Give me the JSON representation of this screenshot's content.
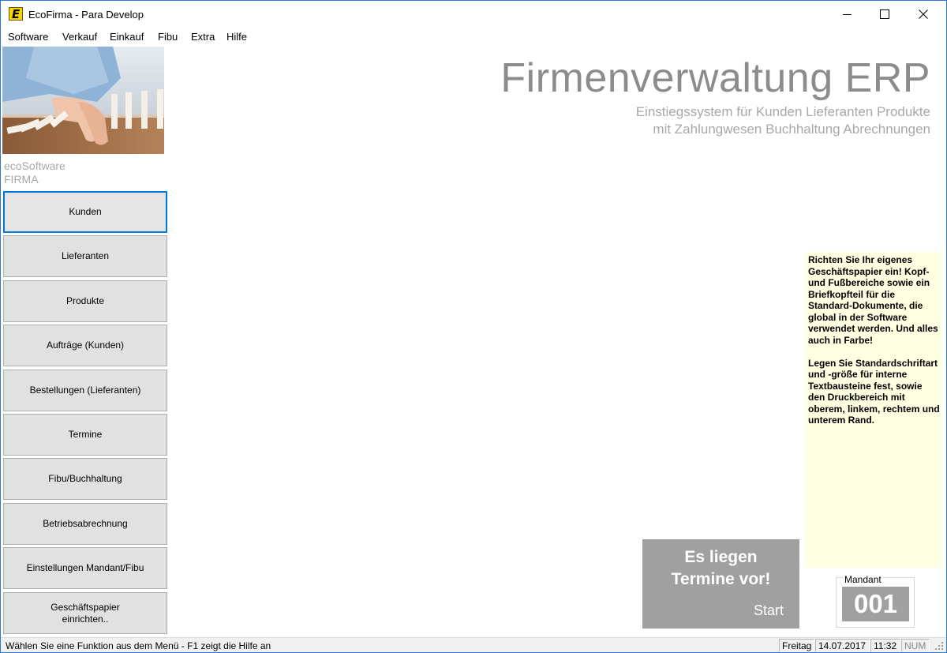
{
  "window": {
    "title": "EcoFirma - Para Develop",
    "logo_letter": "E"
  },
  "menu": [
    {
      "label": "Software"
    },
    {
      "label": "Verkauf"
    },
    {
      "label": "Einkauf"
    },
    {
      "label": "Fibu"
    },
    {
      "label": "Extra"
    },
    {
      "label": "Hilfe"
    }
  ],
  "brand": {
    "line1": "ecoSoftware",
    "line2": "FIRMA"
  },
  "nav": [
    {
      "label": "Kunden"
    },
    {
      "label": "Lieferanten"
    },
    {
      "label": "Produkte"
    },
    {
      "label": "Aufträge (Kunden)"
    },
    {
      "label": "Bestellungen (Lieferanten)"
    },
    {
      "label": "Termine"
    },
    {
      "label": "Fibu/Buchhaltung"
    },
    {
      "label": "Betriebsabrechnung"
    },
    {
      "label": "Einstellungen Mandant/Fibu"
    },
    {
      "label": "Geschäftspapier\neinrichten.."
    }
  ],
  "headline": {
    "title": "Firmenverwaltung ERP",
    "subtitle_1": "Einstiegssystem für Kunden Lieferanten Produkte",
    "subtitle_2": "mit Zahlungwesen Buchhaltung Abrechnungen"
  },
  "hint": {
    "paragraph_1": "Richten Sie Ihr eigenes Geschäftspapier ein! Kopf- und Fußbereiche sowie ein Briefkopfteil für die Standard-Dokumente, die global in der Software verwendet werden. Und alles auch in Farbe!",
    "paragraph_2": "Legen Sie Standardschriftart und -größe für interne Textbausteine fest, sowie den Druckbereich mit oberem, linkem, rechtem und unterem Rand."
  },
  "appointments": {
    "line_1": "Es liegen",
    "line_2": "Termine vor!",
    "start_label": "Start"
  },
  "mandant": {
    "label": "Mandant",
    "value": "001"
  },
  "statusbar": {
    "message": "Wählen Sie eine Funktion aus dem Menü - F1 zeigt die Hilfe an",
    "day": "Freitag",
    "date": "14.07.2017",
    "time": "11:32",
    "num": "NUM"
  },
  "colors": {
    "focus_border": "#0078d7",
    "hint_background": "#ffffe1",
    "panel_gray": "#a0a0a0",
    "heading_gray": "#8c8c8c"
  },
  "icons": {
    "app": "ecofirma-logo-icon",
    "minimize": "minimize-icon",
    "maximize": "maximize-icon",
    "close": "close-icon",
    "grip": "resize-grip-icon"
  }
}
